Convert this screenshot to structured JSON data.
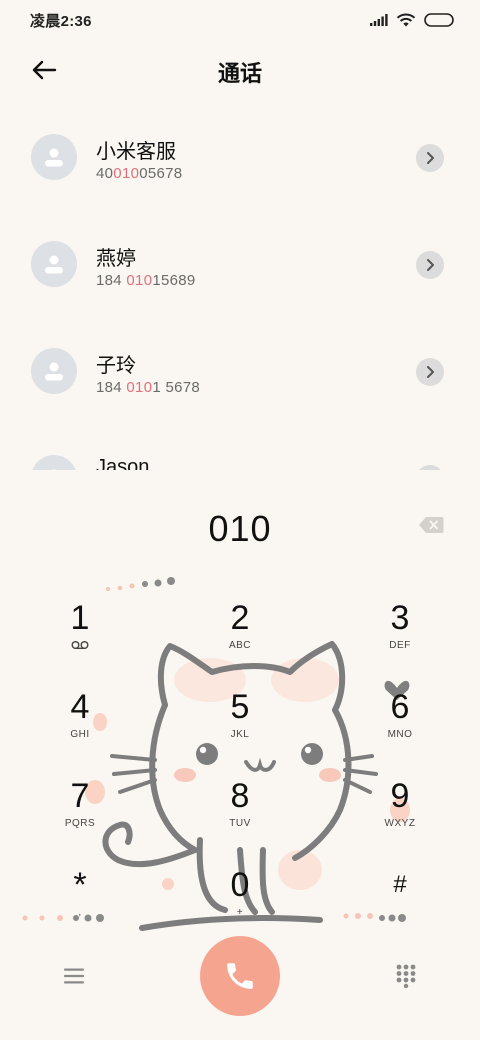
{
  "status_bar": {
    "time": "凌晨2:36",
    "icons": [
      "signal-icon",
      "wifi-icon",
      "battery-icon"
    ]
  },
  "header": {
    "back_icon": "back-arrow-icon",
    "title": "通话"
  },
  "contacts": [
    {
      "name": "小米客服",
      "number_parts": [
        "40",
        "010",
        "05678"
      ]
    },
    {
      "name": "燕婷",
      "number_parts": [
        "184 ",
        "010",
        "15689"
      ]
    },
    {
      "name": "子玲",
      "number_parts": [
        "184 ",
        "010",
        "1 5678"
      ]
    },
    {
      "name": "Jason",
      "number_parts": [
        "",
        "",
        ""
      ]
    }
  ],
  "dialer": {
    "dialed_number": "010",
    "backspace_icon": "backspace-icon"
  },
  "keypad": [
    {
      "digit": "1",
      "letters": "",
      "sub_icon": "voicemail-icon"
    },
    {
      "digit": "2",
      "letters": "ABC"
    },
    {
      "digit": "3",
      "letters": "DEF"
    },
    {
      "digit": "4",
      "letters": "GHI"
    },
    {
      "digit": "5",
      "letters": "JKL"
    },
    {
      "digit": "6",
      "letters": "MNO"
    },
    {
      "digit": "7",
      "letters": "PQRS"
    },
    {
      "digit": "8",
      "letters": "TUV"
    },
    {
      "digit": "9",
      "letters": "WXYZ"
    },
    {
      "digit": "*",
      "letters": ","
    },
    {
      "digit": "0",
      "letters": "+"
    },
    {
      "digit": "#",
      "letters": ""
    }
  ],
  "bottom_bar": {
    "menu_icon": "menu-icon",
    "call_icon": "phone-icon",
    "keypad_icon": "dialpad-icon"
  },
  "colors": {
    "background": "#faf6f1",
    "highlight": "#e0707a",
    "call_button": "#f5a58f",
    "avatar": "#dde0e5"
  }
}
